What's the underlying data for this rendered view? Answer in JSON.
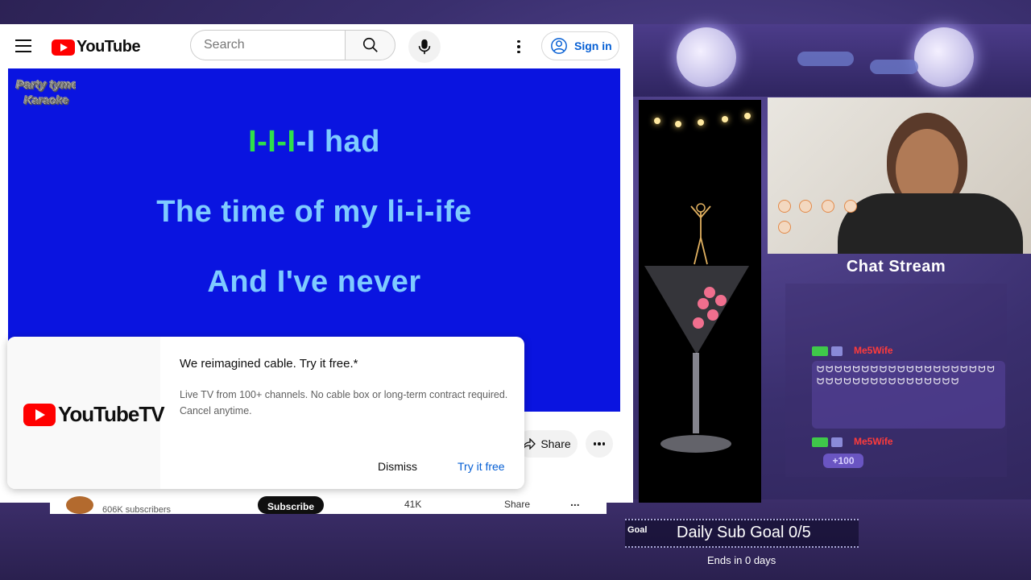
{
  "youtube": {
    "header": {
      "logo_text": "YouTube",
      "search_placeholder": "Search",
      "signin_label": "Sign in"
    },
    "video": {
      "watermark": "Party Tyme Karaoke",
      "lyrics": [
        {
          "highlight": "I-I-I",
          "rest": "-I had"
        },
        {
          "highlight": "",
          "rest": "The time of my li-i-ife"
        },
        {
          "highlight": "",
          "rest": "And I've never"
        }
      ]
    },
    "actions": {
      "share_label": "Share"
    },
    "under_strip": {
      "subscribers": "606K subscribers",
      "subscribe_label": "Subscribe",
      "likes": "41K",
      "share_label": "Share",
      "more_label": "..."
    },
    "promo": {
      "logo_text": "YouTubeTV",
      "title": "We reimagined cable. Try it free.*",
      "body": "Live TV from 100+ channels. No cable box or long-term contract required. Cancel anytime.",
      "dismiss_label": "Dismiss",
      "try_label": "Try it free"
    }
  },
  "stream_overlay": {
    "chat": {
      "title": "Chat Stream",
      "messages": [
        {
          "user": "Me5Wife",
          "text": "ᗢᗢᗢᗢᗢᗢᗢᗢᗢᗢᗢᗢᗢᗢᗢᗢᗢᗢᗢᗢᗢᗢᗢᗢᗢᗢᗢᗢᗢᗢᗢᗢᗢᗢᗢᗢ"
        },
        {
          "user": "Me5Wife",
          "bits": "+100"
        }
      ]
    },
    "goal": {
      "label": "Goal",
      "text": "Daily Sub Goal 0/5",
      "ends": "Ends in 0 days"
    }
  },
  "colors": {
    "youtube_red": "#ff0000",
    "video_bg": "#0a14e0",
    "lyric_color": "#7ecbff",
    "lyric_highlight": "#2fe04a",
    "link_blue": "#065fd4"
  }
}
